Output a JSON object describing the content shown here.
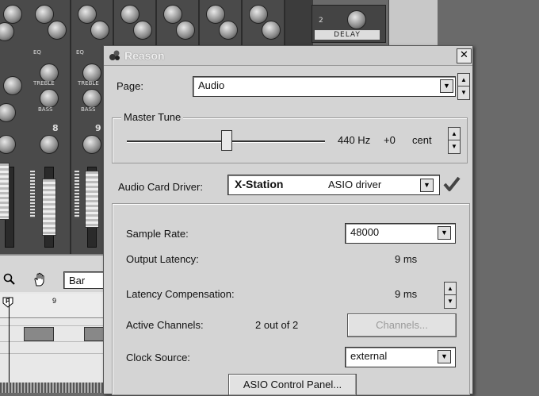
{
  "background": {
    "mixer_eq_labels": [
      "EQ",
      "EQ",
      "EQ"
    ],
    "mixer_treble_labels": [
      "TREBLE",
      "TREBLE",
      "TREBLE"
    ],
    "mixer_bass_labels": [
      "BASS",
      "BASS",
      "BASS"
    ],
    "channel_numbers": [
      "8",
      "9"
    ],
    "delay_label": "DELAY",
    "delay_knob_number": "2",
    "sequencer": {
      "mode_value": "Bar",
      "position_marker": "P",
      "bar_number": "9"
    }
  },
  "dialog": {
    "title": "Reason",
    "page_label": "Page:",
    "page_value": "Audio",
    "master_tune": {
      "legend": "Master Tune",
      "hz_value": "440 Hz",
      "offset": "+0",
      "unit": "cent",
      "slider_level_fraction": 0.5
    },
    "audio_card": {
      "label": "Audio Card Driver:",
      "device": "X-Station",
      "driver": "ASIO driver"
    },
    "sample_rate": {
      "label": "Sample Rate:",
      "value": "48000"
    },
    "output_latency": {
      "label": "Output Latency:",
      "value": "9 ms"
    },
    "latency_compensation": {
      "label": "Latency Compensation:",
      "value": "9 ms"
    },
    "active_channels": {
      "label": "Active Channels:",
      "value": "2 out of 2",
      "button": "Channels..."
    },
    "clock_source": {
      "label": "Clock Source:",
      "value": "external"
    },
    "asio_button": "ASIO Control Panel..."
  },
  "colors": {
    "dialog_bg": "#d4d4d4",
    "disabled_text": "#9a9a9a"
  }
}
